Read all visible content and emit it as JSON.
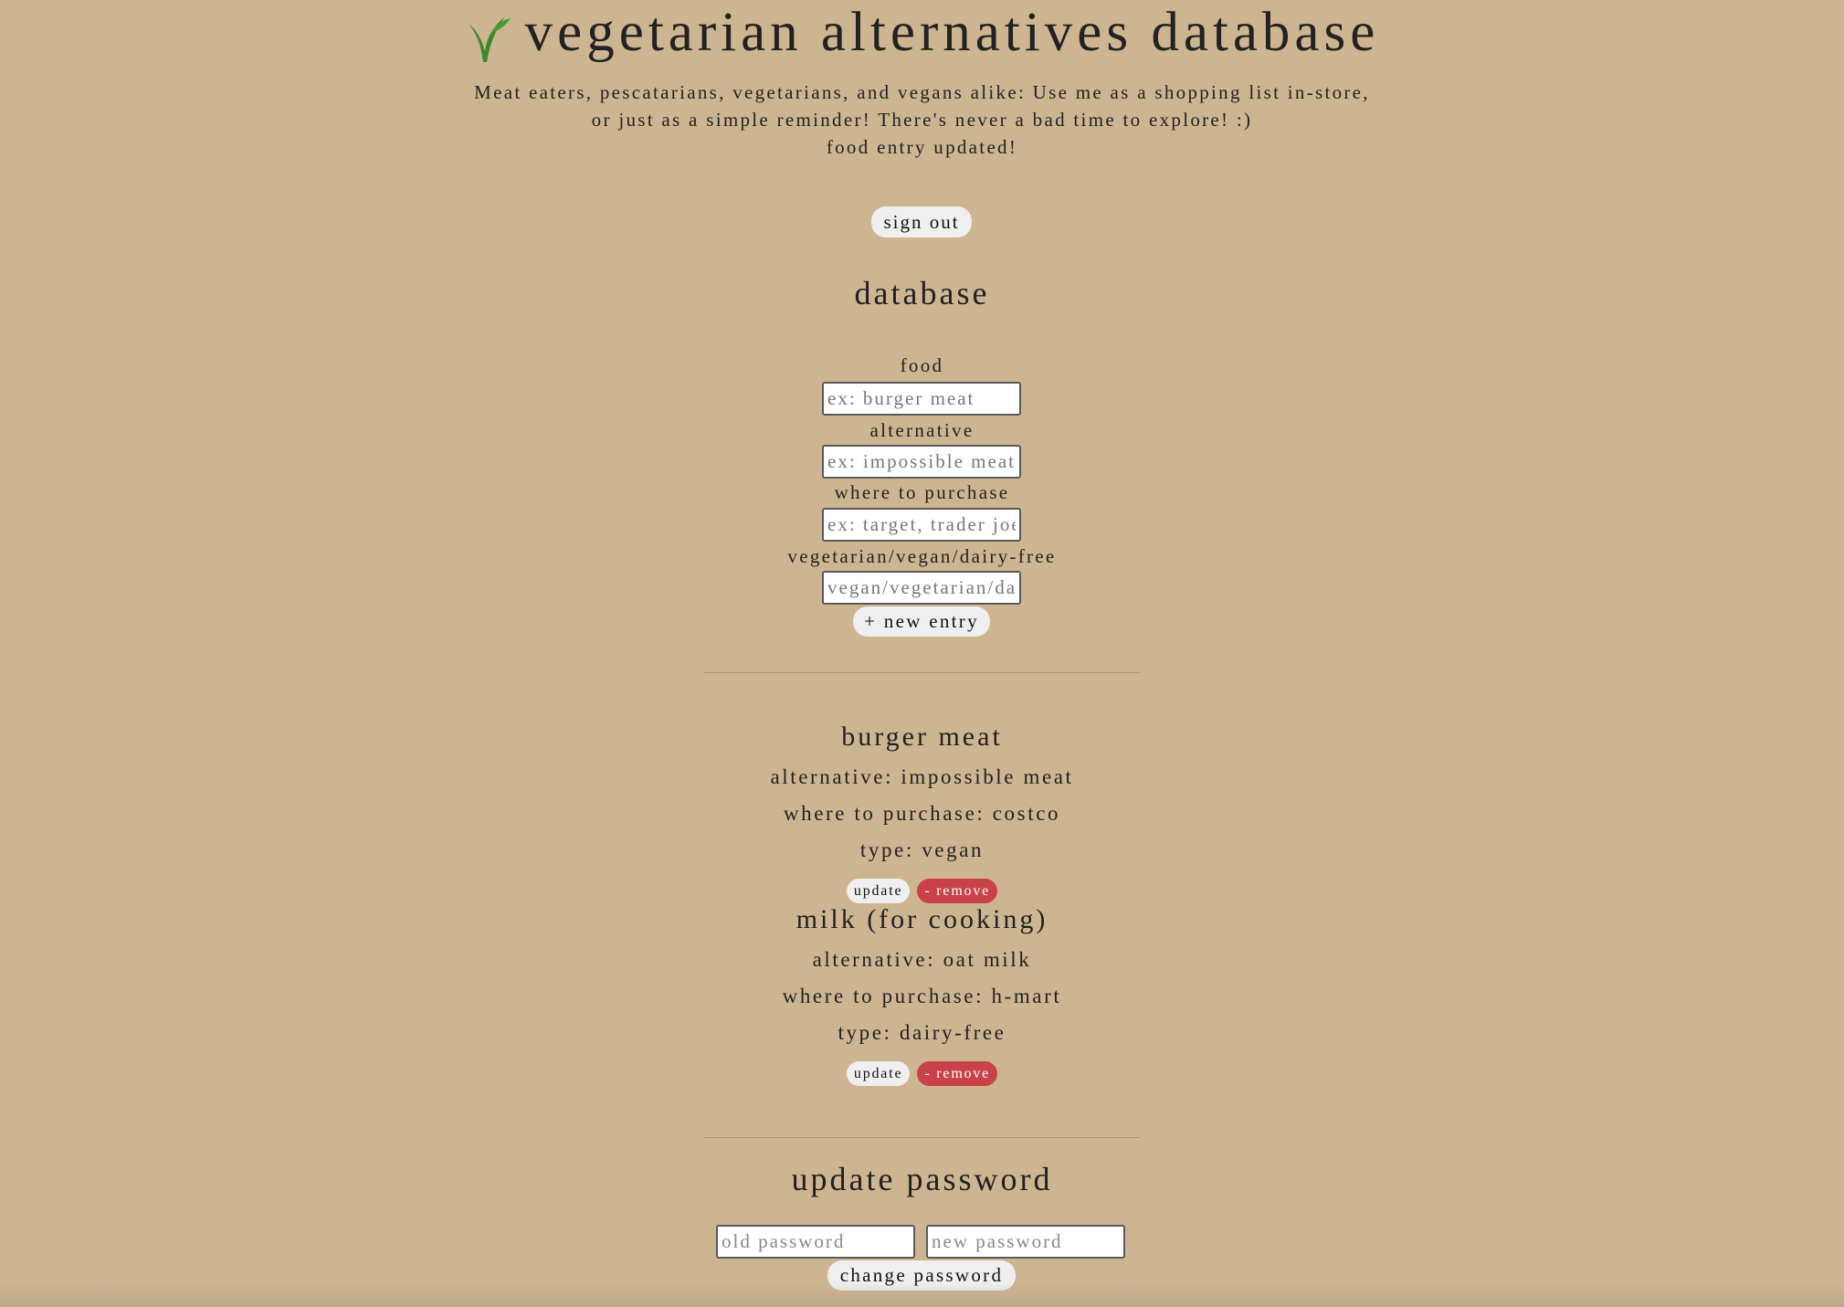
{
  "header": {
    "logo_icon": "leaf-sprout-icon",
    "title": "vegetarian alternatives database",
    "tagline_line1": "Meat eaters, pescatarians, vegetarians, and vegans alike: Use me as a shopping list in-store,",
    "tagline_line2": "or just as a simple reminder! There's never a bad time to explore! :)",
    "status_message": "food entry updated!"
  },
  "auth": {
    "sign_out_label": "sign out"
  },
  "database": {
    "title": "database",
    "form": {
      "food_label": "food",
      "food_placeholder": "ex: burger meat",
      "alternative_label": "alternative",
      "alternative_placeholder": "ex: impossible meat",
      "purchase_label": "where to purchase",
      "purchase_placeholder": "ex: target, trader joe's",
      "type_label": "vegetarian/vegan/dairy-free",
      "type_placeholder": "vegan/vegetarian/dairy-free",
      "new_entry_label": "+ new entry"
    },
    "entries": [
      {
        "food": "burger meat",
        "alternative": "alternative: impossible meat",
        "purchase": "where to purchase: costco",
        "type": "type: vegan",
        "update_label": "update",
        "remove_label": "- remove"
      },
      {
        "food": "milk (for cooking)",
        "alternative": "alternative: oat milk",
        "purchase": "where to purchase: h-mart",
        "type": "type: dairy-free",
        "update_label": "update",
        "remove_label": "- remove"
      }
    ]
  },
  "password": {
    "title": "update password",
    "old_placeholder": "old password",
    "new_placeholder": "new password",
    "change_label": "change password"
  },
  "colors": {
    "background": "#cdb592",
    "danger": "#c9424a",
    "leaf": "#3a8a2a"
  }
}
